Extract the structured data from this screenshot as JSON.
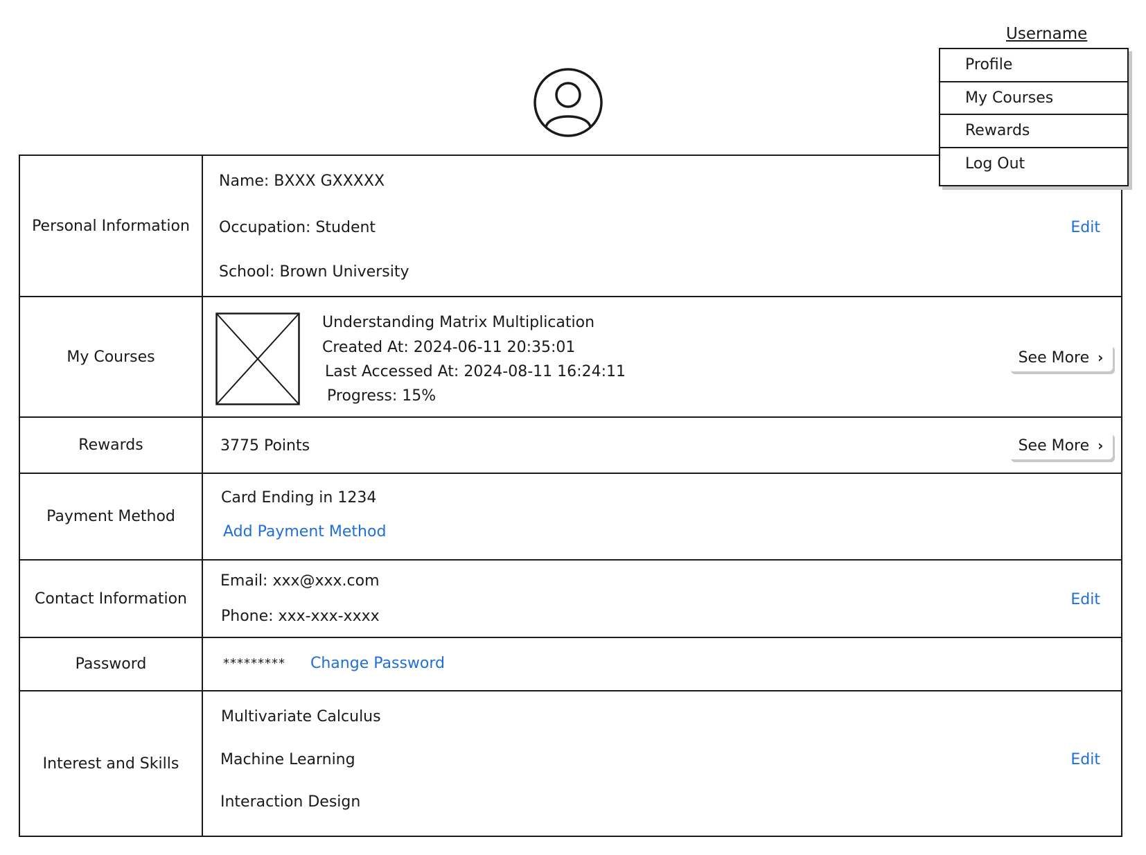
{
  "header": {
    "username": "Username",
    "menu": [
      "Profile",
      "My Courses",
      "Rewards",
      "Log Out"
    ]
  },
  "avatar_icon": "user-circle-icon",
  "personal": {
    "label": "Personal Information",
    "name": "Name: BXXX GXXXXX",
    "occupation": "Occupation: Student",
    "school": "School: Brown University",
    "edit": "Edit"
  },
  "courses": {
    "label": "My Courses",
    "title": "Understanding Matrix Multiplication",
    "created": "Created At: 2024-06-11 20:35:01",
    "accessed": "Last Accessed At: 2024-08-11 16:24:11",
    "progress": "Progress: 15%",
    "see_more": "See More"
  },
  "rewards": {
    "label": "Rewards",
    "points": "3775 Points",
    "see_more": "See More"
  },
  "payment": {
    "label": "Payment Method",
    "card": "Card Ending in 1234",
    "add": "Add Payment Method"
  },
  "contact": {
    "label": "Contact Information",
    "email": "Email: xxx@xxx.com",
    "phone": "Phone: xxx-xxx-xxxx",
    "edit": "Edit"
  },
  "password": {
    "label": "Password",
    "masked": "*********",
    "change": "Change Password"
  },
  "interests": {
    "label": "Interest and Skills",
    "items": [
      "Multivariate Calculus",
      "Machine Learning",
      "Interaction Design"
    ],
    "edit": "Edit"
  },
  "colors": {
    "link": "#1f6fd6",
    "border": "#1a1a1a",
    "shadow": "#c8c8c8"
  }
}
